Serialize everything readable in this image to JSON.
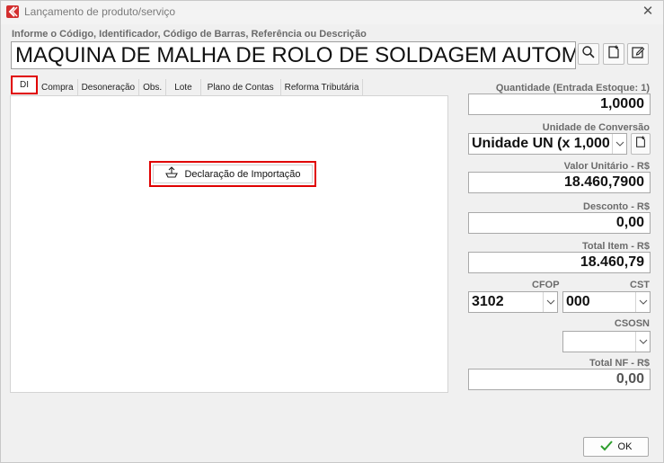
{
  "window": {
    "title": "Lançamento de produto/serviço",
    "close_glyph": "✕",
    "accent_color": "#e00000"
  },
  "search": {
    "label": "Informe o Código, Identificador, Código de Barras, Referência ou Descrição",
    "value": "MAQUINA DE MALHA DE ROLO DE SOLDAGEM AUTOMA",
    "icons": [
      "search-icon",
      "new-document-icon",
      "edit-icon"
    ]
  },
  "tabs": [
    {
      "label": "DI",
      "active": true
    },
    {
      "label": "Compra"
    },
    {
      "label": "Desoneração"
    },
    {
      "label": "Obs."
    },
    {
      "label": "Lote"
    },
    {
      "label": "Plano de Contas"
    },
    {
      "label": "Reforma Tributária"
    }
  ],
  "di_panel": {
    "button_label": "Declaração de Importação"
  },
  "fields": {
    "quantidade": {
      "label": "Quantidade (Entrada Estoque: 1)",
      "value": "1,0000"
    },
    "unidade": {
      "label": "Unidade de Conversão",
      "value": "Unidade UN (x 1,000"
    },
    "valor_unitario": {
      "label": "Valor Unitário - R$",
      "value": "18.460,7900"
    },
    "desconto": {
      "label": "Desconto - R$",
      "value": "0,00"
    },
    "total_item": {
      "label": "Total Item - R$",
      "value": "18.460,79"
    },
    "cfop": {
      "label": "CFOP",
      "value": "3102"
    },
    "cst": {
      "label": "CST",
      "value": "000"
    },
    "csosn": {
      "label": "CSOSN",
      "value": ""
    },
    "total_nf": {
      "label": "Total NF - R$",
      "value": "0,00"
    }
  },
  "footer": {
    "ok_label": "OK",
    "ok_icon": "check-icon",
    "ok_color": "#2e9e2e"
  }
}
